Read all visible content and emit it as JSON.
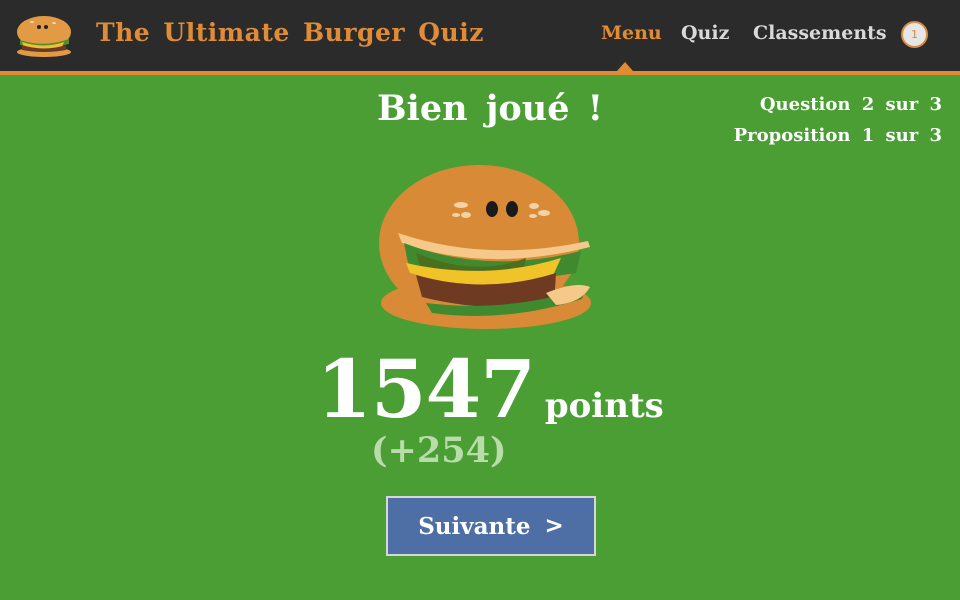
{
  "header": {
    "app_title": "The Ultimate Burger Quiz",
    "logo_icon": "burger-logo-icon",
    "nav": [
      {
        "label": "Menu",
        "active": true
      },
      {
        "label": "Quiz",
        "active": false
      },
      {
        "label": "Classements",
        "active": false
      }
    ],
    "user_badge": "1"
  },
  "result": {
    "headline": "Bien joué !",
    "question_progress": "Question 2 sur 3",
    "proposition_progress": "Proposition 1 sur 3",
    "mascot_icon": "happy-burger-icon",
    "score": "1547",
    "score_unit": "points",
    "gain": "(+254)"
  },
  "actions": {
    "next_label": "Suivante",
    "next_arrow": ">"
  },
  "colors": {
    "background": "#4a9e33",
    "topbar": "#2b2b2b",
    "accent": "#e08c37",
    "button": "#4d6fa6"
  }
}
